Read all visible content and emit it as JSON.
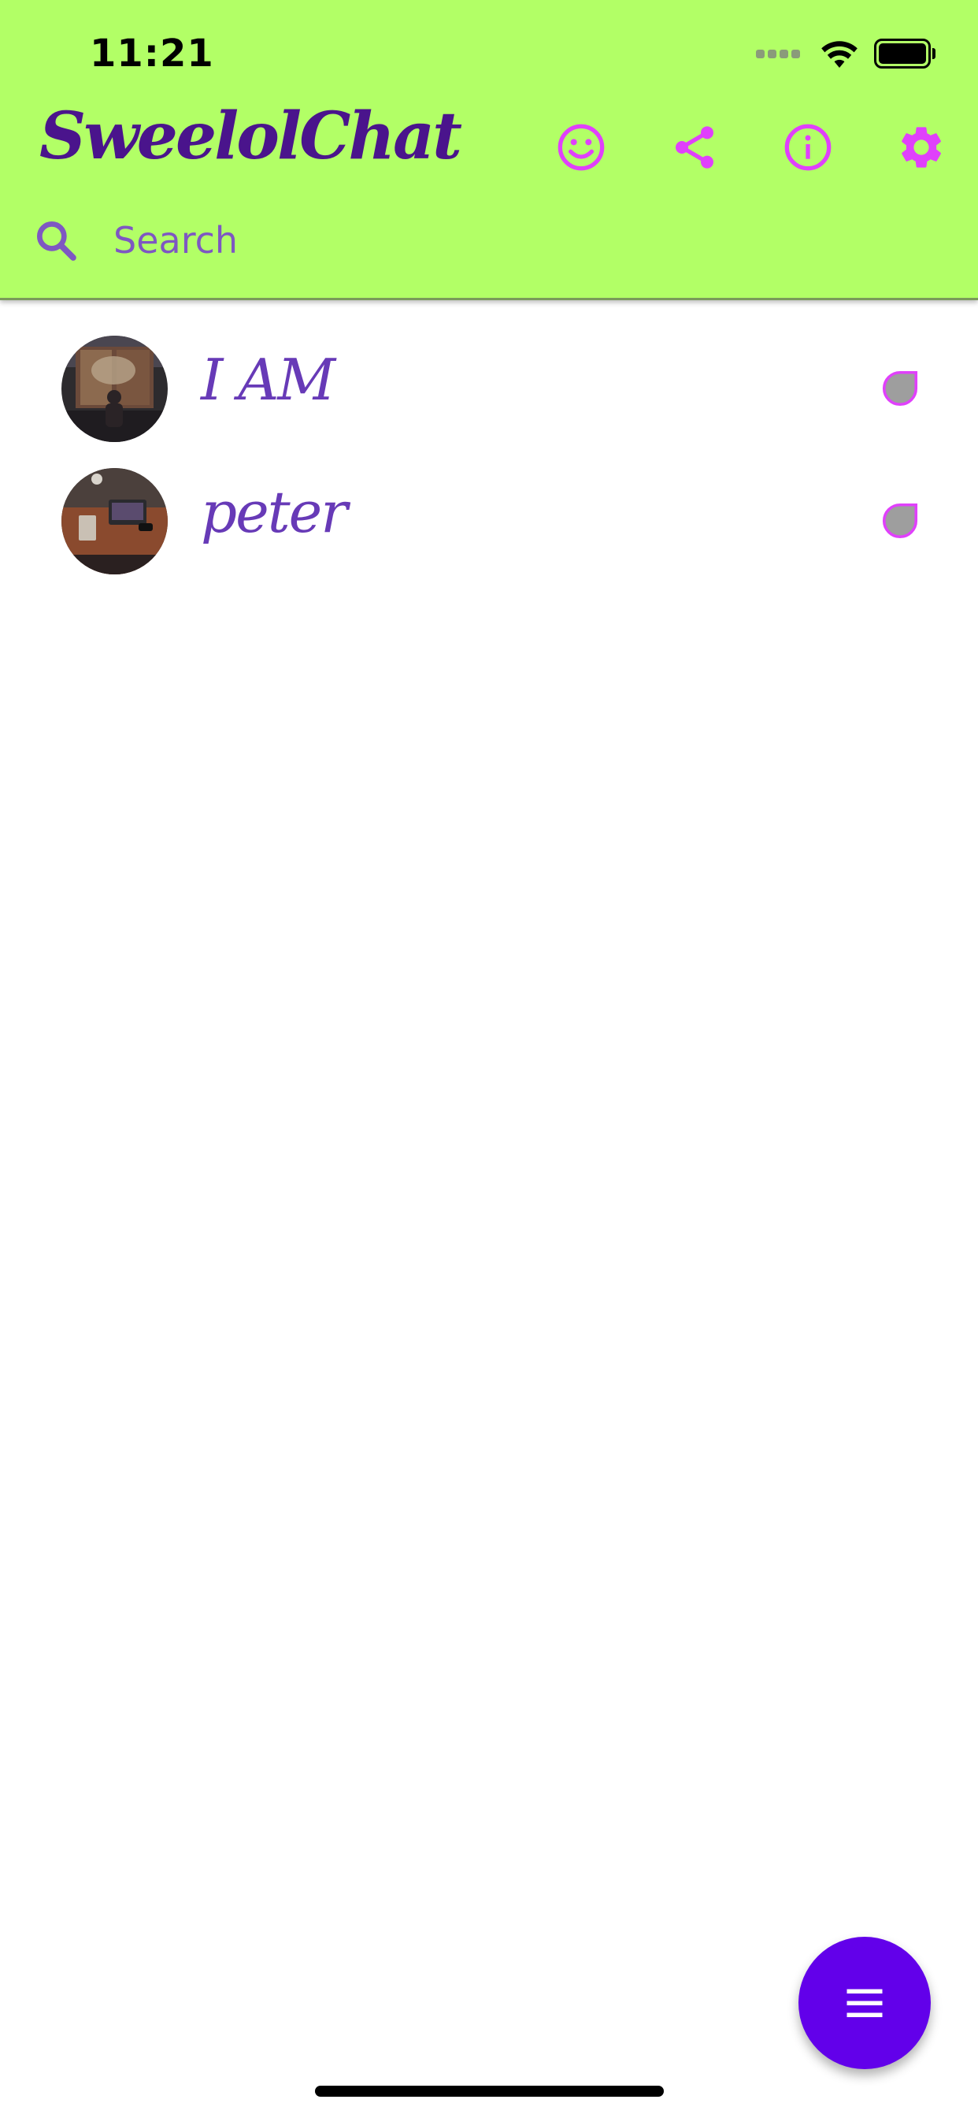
{
  "status_bar": {
    "time": "11:21"
  },
  "app": {
    "title": "SweelolChat"
  },
  "toolbar": {
    "icons": [
      "smiley-icon",
      "share-icon",
      "info-icon",
      "gear-icon"
    ]
  },
  "search": {
    "placeholder": "Search"
  },
  "chats": [
    {
      "name": "I AM",
      "avatar": "avatar-art-gallery",
      "status_icon": "status-drop-icon"
    },
    {
      "name": "peter",
      "avatar": "avatar-desk-laptop",
      "status_icon": "status-drop-icon"
    }
  ],
  "colors": {
    "header_bg": "#b2ff66",
    "title": "#4a148c",
    "accent_icon": "#e040fb",
    "search_text": "#7e57c2",
    "chat_name": "#673ab7",
    "fab": "#6200ea",
    "status_drop_fill": "#9e9e9e"
  },
  "fab": {
    "icon": "menu-icon"
  }
}
